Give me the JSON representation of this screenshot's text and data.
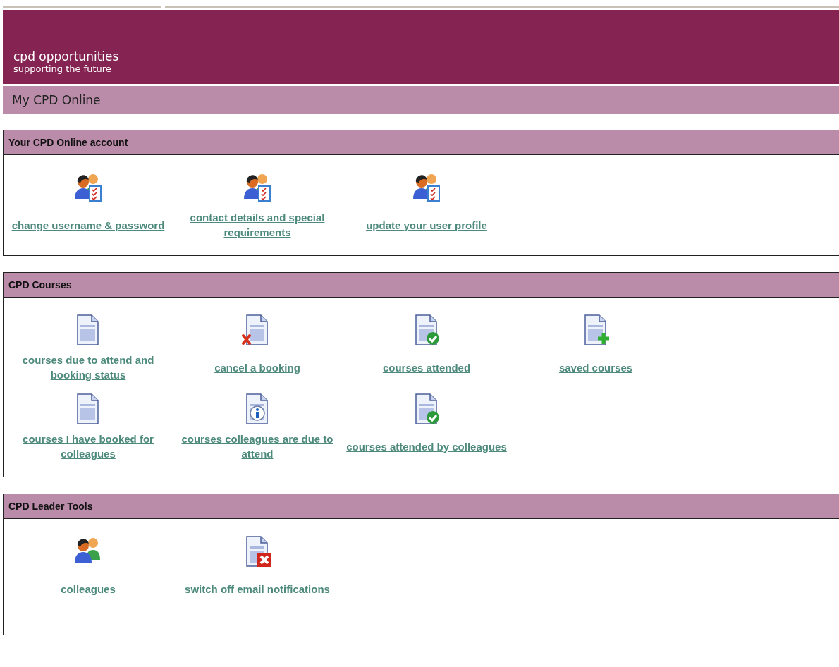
{
  "banner": {
    "title": "cpd opportunities",
    "tagline": "supporting the future"
  },
  "page_title": "My CPD Online",
  "sections": [
    {
      "title": "Your CPD Online account",
      "items": [
        {
          "kind": "people-checklist",
          "label": "change username & password"
        },
        {
          "kind": "people-checklist",
          "label": "contact details and special requirements"
        },
        {
          "kind": "people-checklist",
          "label": "update your user profile"
        }
      ]
    },
    {
      "title": "CPD Courses",
      "items": [
        {
          "kind": "document",
          "label": "courses due to attend and booking status"
        },
        {
          "kind": "document-cross",
          "label": "cancel a booking"
        },
        {
          "kind": "document-check",
          "label": "courses attended"
        },
        {
          "kind": "document-plus",
          "label": "saved courses"
        },
        {
          "kind": "document",
          "label": "courses I have booked for colleagues"
        },
        {
          "kind": "document-info",
          "label": "courses colleagues are due to attend"
        },
        {
          "kind": "document-check",
          "label": "courses attended by colleagues"
        }
      ]
    },
    {
      "title": "CPD Leader Tools",
      "items": [
        {
          "kind": "people",
          "label": "colleagues"
        },
        {
          "kind": "document-delete",
          "label": "switch off email notifications"
        }
      ]
    }
  ]
}
